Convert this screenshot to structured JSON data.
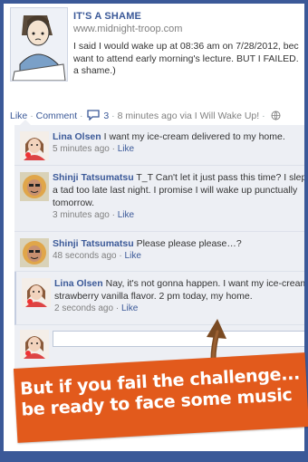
{
  "story": {
    "title": "IT'S A SHAME",
    "url": "www.midnight-troop.com",
    "lines": [
      "I said I would wake up at 08:36 am on 7/28/2012, bec",
      "want to attend early morning's lecture. BUT I FAILED.",
      "a shame.)"
    ]
  },
  "actions": {
    "like": "Like",
    "comment": "Comment",
    "comment_count": "3",
    "meta": "8 minutes ago via I Will Wake Up!",
    "sep": "·"
  },
  "comments": [
    {
      "author": "Lina Olsen",
      "text": "I want my ice-cream delivered to my home.",
      "time": "5 minutes ago",
      "like": "Like"
    },
    {
      "author": "Shinji Tatsumatsu",
      "text": "T_T Can't let it just pass this time? I slept a tad too late last night. I promise I will wake up punctually tomorrow.",
      "time": "3 minutes ago",
      "like": "Like"
    },
    {
      "author": "Shinji Tatsumatsu",
      "text": "Please please please…?",
      "time": "48 seconds ago",
      "like": "Like"
    },
    {
      "author": "Lina Olsen",
      "text": "Nay, it's not gonna happen. I want my ice-cream, strawberry vanilla flavor. 2 pm today, my home.",
      "time": "2 seconds ago",
      "like": "Like"
    }
  ],
  "banner": {
    "line1": "But if you fail the challenge...",
    "line2": "be ready to face some music"
  },
  "colors": {
    "frame": "#3b5998",
    "link": "#3b5998",
    "thread_bg": "#edeff4",
    "banner": "#e25a1c"
  }
}
